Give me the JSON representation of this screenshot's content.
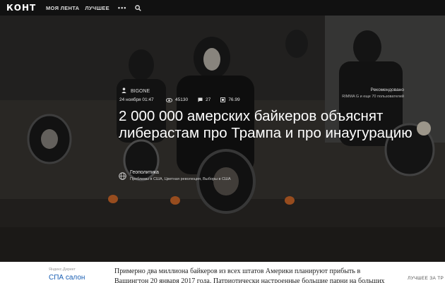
{
  "header": {
    "logo": "КОНТ",
    "nav": [
      "МОЯ ЛЕНТА",
      "ЛУЧШЕЕ"
    ],
    "more_icon": "more-dots-icon",
    "search_icon": "search-icon",
    "colors": {
      "bar": "#111111",
      "text": "#dddddd"
    }
  },
  "article": {
    "author": "BIGONE",
    "date": "24 ноября 01:47",
    "views": "45130",
    "comments": "27",
    "rating": "76.99",
    "title": "2 000 000 амерских байкеров объяснят либерастам про Трампа и про инаугурацию",
    "category": "Геополитика",
    "tags": "Проблемы в США, Цветная революция, Выборы в США",
    "recommended_title": "Рекомендовано",
    "recommended_sub": "RIMMA G и еще 70 пользователей",
    "body_text": "Примерно два миллиона байкеров из всех штатов Америки планируют прибыть в Вашингтон 20 января 2017 года. Патриотически настроенные большие парни на больших"
  },
  "sidebar": {
    "ad_label": "Яндекс.Директ",
    "ad_link": "СПА салон",
    "best_label": "ЛУЧШЕЕ ЗА ТР"
  },
  "icons": {
    "author": "person-icon",
    "views": "eye-icon",
    "comments": "comment-icon",
    "rating": "rating-icon",
    "category": "globe-icon"
  }
}
